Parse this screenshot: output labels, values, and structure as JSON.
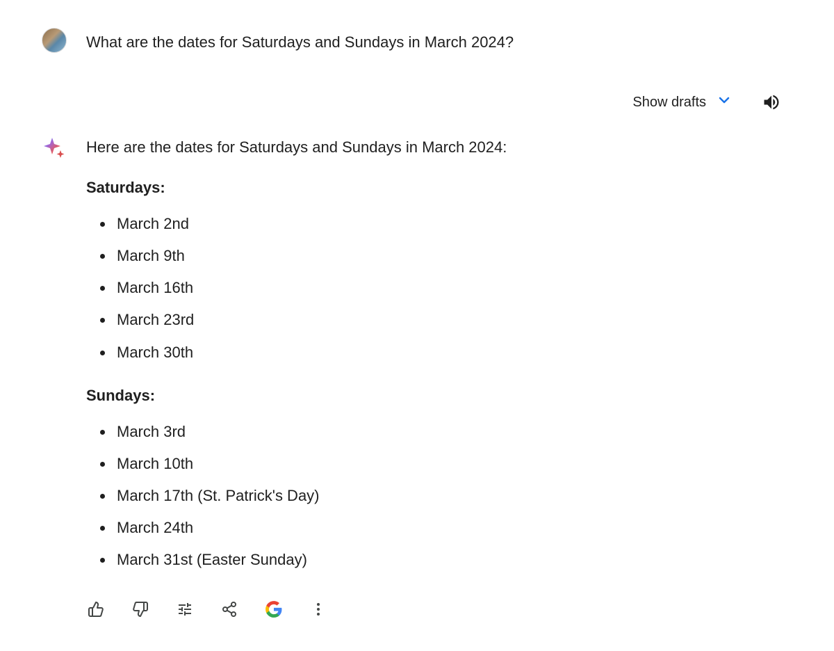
{
  "user": {
    "question": "What are the dates for Saturdays and Sundays in March 2024?"
  },
  "drafts": {
    "label": "Show drafts"
  },
  "response": {
    "intro": "Here are the dates for Saturdays and Sundays in March 2024:",
    "sections": [
      {
        "heading": "Saturdays:",
        "items": [
          "March 2nd",
          "March 9th",
          "March 16th",
          "March 23rd",
          "March 30th"
        ]
      },
      {
        "heading": "Sundays:",
        "items": [
          "March 3rd",
          "March 10th",
          "March 17th (St. Patrick's Day)",
          "March 24th",
          "March 31st (Easter Sunday)"
        ]
      }
    ]
  }
}
